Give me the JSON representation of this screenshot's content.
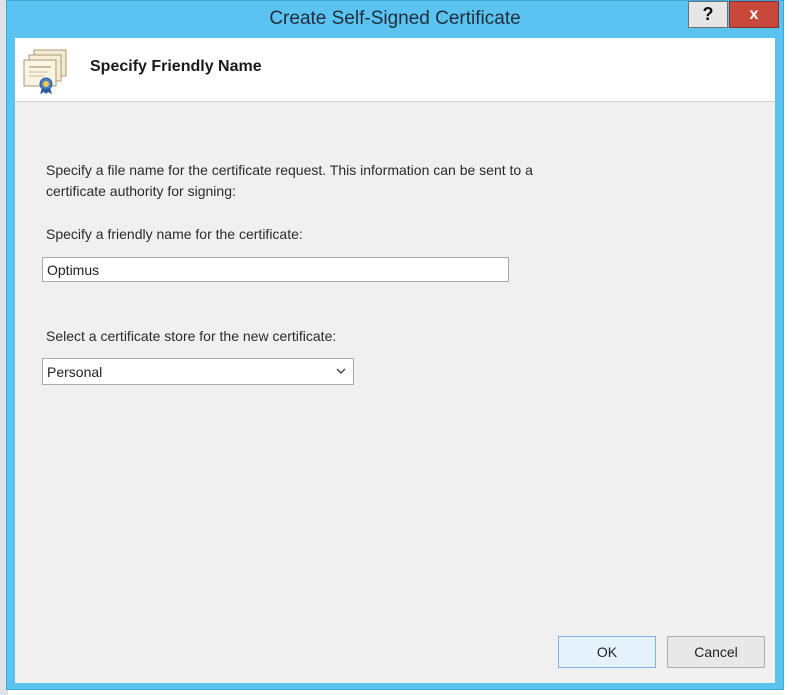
{
  "window": {
    "title": "Create Self-Signed Certificate",
    "help_label": "?",
    "close_label": "x"
  },
  "header": {
    "title": "Specify Friendly Name",
    "icon": "certificate-icon"
  },
  "body": {
    "description": "Specify a file name for the certificate request.  This information can be sent to a certificate authority for signing:",
    "friendly_name_label": "Specify a friendly name for the certificate:",
    "friendly_name_value": "Optimus",
    "store_label": "Select a certificate store for the new certificate:",
    "store_value": "Personal"
  },
  "buttons": {
    "ok_label": "OK",
    "cancel_label": "Cancel"
  },
  "colors": {
    "titlebar": "#5bc3f0",
    "close_button": "#c9483c",
    "dialog_background": "#f0f0f0"
  }
}
